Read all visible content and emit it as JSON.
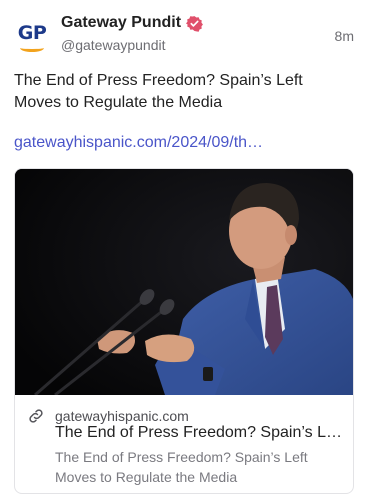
{
  "author": {
    "logo_text": "GP",
    "display_name": "Gateway Pundit",
    "handle": "@gatewaypundit",
    "verified": true,
    "verified_icon": "verified-badge-icon"
  },
  "post": {
    "time": "8m",
    "text": "The End of Press Freedom? Spain’s Left Moves to Regulate the Media",
    "link_text": "gatewayhispanic.com/2024/09/th…"
  },
  "card": {
    "image_icon": "speaker-at-podium-photo",
    "domain": "gatewayhispanic.com",
    "domain_icon": "link-icon",
    "title": "The End of Press Freedom? Spain’s L…",
    "description": "The End of Press Freedom? Spain’s Left Moves to Regulate the Media"
  },
  "colors": {
    "link": "#4a55c9",
    "verified_badge": "#e0506b",
    "logo_blue": "#1d3a8a",
    "logo_orange": "#f2a31d"
  }
}
